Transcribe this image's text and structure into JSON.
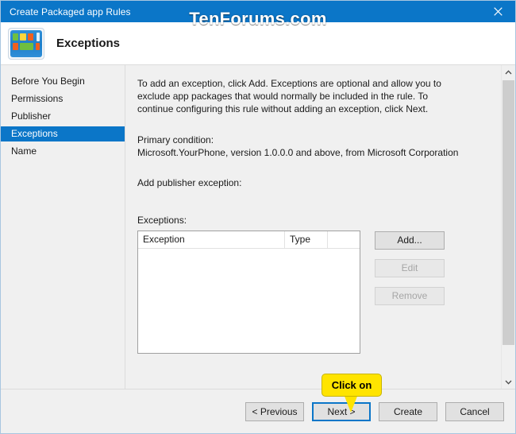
{
  "window": {
    "title": "Create Packaged app Rules",
    "close_label": "Close",
    "close_icon": "close-icon"
  },
  "watermark": {
    "text": "TenForums.com"
  },
  "header": {
    "title": "Exceptions",
    "icon": "packaged-app-icon"
  },
  "sidebar": {
    "items": [
      {
        "label": "Before You Begin",
        "selected": false
      },
      {
        "label": "Permissions",
        "selected": false
      },
      {
        "label": "Publisher",
        "selected": false
      },
      {
        "label": "Exceptions",
        "selected": true
      },
      {
        "label": "Name",
        "selected": false
      }
    ]
  },
  "main": {
    "intro": "To add an exception, click Add. Exceptions are optional and allow you to exclude app packages that would normally be included in the rule. To continue configuring this rule without adding an exception, click Next.",
    "primary_condition_label": "Primary condition:",
    "primary_condition_value": "Microsoft.YourPhone, version 1.0.0.0 and above, from Microsoft Corporation",
    "add_publisher_label": "Add publisher exception:",
    "exceptions_label": "Exceptions:",
    "list": {
      "columns": [
        "Exception",
        "Type"
      ],
      "rows": []
    },
    "side_buttons": [
      {
        "label": "Add...",
        "enabled": true
      },
      {
        "label": "Edit",
        "enabled": false
      },
      {
        "label": "Remove",
        "enabled": false
      }
    ]
  },
  "scrollbar": {
    "up_icon": "chevron-up-icon",
    "down_icon": "chevron-down-icon"
  },
  "footer": {
    "buttons": [
      {
        "label": "< Previous",
        "focused": false
      },
      {
        "label": "Next >",
        "focused": true
      },
      {
        "label": "Create",
        "focused": false
      },
      {
        "label": "Cancel",
        "focused": false
      }
    ]
  },
  "callout": {
    "text": "Click on"
  },
  "colors": {
    "accent": "#0b76c8",
    "callout": "#ffe400",
    "window_bg": "#f0f0f0"
  }
}
